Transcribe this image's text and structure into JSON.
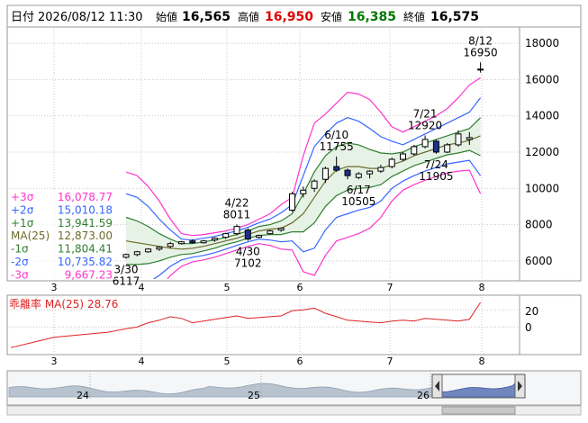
{
  "header": {
    "date_label": "日付",
    "datetime": "2026/08/12 11:30",
    "open_label": "始値",
    "open": "16,565",
    "high_label": "高値",
    "high": "16,950",
    "low_label": "安値",
    "low": "16,385",
    "close_label": "終値",
    "close": "16,575"
  },
  "colors": {
    "up": "#ffffff",
    "down": "#1f2f8f",
    "candle_edge": "#000000",
    "sigma3": "#ff33cc",
    "sigma2": "#3366ff",
    "sigma1": "#2f7f2f",
    "ma": "#6b6b2b",
    "band_fill": "#e6f2e6",
    "high_text": "#dd0000",
    "low_text": "#007700",
    "divergence": "#dd2222",
    "navigator_fill": "#b7c3cf",
    "navigator_selected": "#6f86bf"
  },
  "legend": [
    {
      "label": "+3σ",
      "value": "16,078.77",
      "color": "#ff33cc"
    },
    {
      "label": "+2σ",
      "value": "15,010.18",
      "color": "#3366ff"
    },
    {
      "label": "+1σ",
      "value": "13,941.59",
      "color": "#2f7f2f"
    },
    {
      "label": "MA(25)",
      "value": "12,873.00",
      "color": "#6b6b2b"
    },
    {
      "label": "-1σ",
      "value": "11,804.41",
      "color": "#2f7f2f"
    },
    {
      "label": "-2σ",
      "value": "10,735.82",
      "color": "#3366ff"
    },
    {
      "label": "-3σ",
      "value": "9,667.23",
      "color": "#ff33cc"
    }
  ],
  "divergence_panel": {
    "label": "乖離率 MA(25)",
    "value": "28.76",
    "y_ticks": [
      "20",
      "0"
    ]
  },
  "x_axis_months": [
    "3",
    "4",
    "5",
    "6",
    "7",
    "8"
  ],
  "navigator": {
    "labels": [
      "24",
      "25",
      "26"
    ]
  },
  "chart_data": {
    "type": "candlestick",
    "title": "",
    "xlabel": "",
    "ylabel": "",
    "y_ticks": [
      6000,
      8000,
      10000,
      12000,
      14000,
      16000,
      18000
    ],
    "ylim": [
      5000,
      18800
    ],
    "x_ticks": [
      "3",
      "4",
      "5",
      "6",
      "7",
      "8"
    ],
    "series": [
      {
        "name": "+3σ",
        "values": [
          10900,
          10700,
          10100,
          9300,
          8300,
          7500,
          7400,
          7450,
          7550,
          7650,
          7800,
          8000,
          8300,
          8600,
          9100,
          9500,
          11800,
          13600,
          14100,
          14700,
          15300,
          15200,
          14900,
          14200,
          13400,
          13100,
          13400,
          13700,
          14000,
          14400,
          15000,
          15700,
          16100
        ]
      },
      {
        "name": "+2σ",
        "values": [
          9700,
          9500,
          9000,
          8300,
          7700,
          7200,
          7150,
          7250,
          7350,
          7500,
          7650,
          7850,
          8100,
          8300,
          8650,
          9100,
          10700,
          12300,
          13000,
          13600,
          13900,
          13700,
          13300,
          12850,
          12600,
          12400,
          12700,
          13000,
          13300,
          13600,
          13900,
          14200,
          15000
        ]
      },
      {
        "name": "+1σ",
        "values": [
          8400,
          8200,
          7900,
          7500,
          7200,
          6950,
          6950,
          7050,
          7150,
          7300,
          7450,
          7650,
          7900,
          8000,
          8200,
          8600,
          9700,
          10900,
          11800,
          12300,
          12500,
          12400,
          12150,
          11950,
          11900,
          12000,
          12300,
          12500,
          12700,
          12900,
          13100,
          13300,
          13900
        ]
      },
      {
        "name": "MA(25)",
        "values": [
          7100,
          7000,
          6900,
          6800,
          6700,
          6650,
          6700,
          6800,
          6950,
          7100,
          7250,
          7450,
          7650,
          7750,
          7800,
          8100,
          8600,
          9500,
          10400,
          11000,
          11200,
          11200,
          11100,
          11100,
          11300,
          11500,
          11800,
          12000,
          12200,
          12400,
          12500,
          12650,
          12900
        ]
      },
      {
        "name": "-1σ",
        "values": [
          5800,
          5800,
          5850,
          6000,
          6200,
          6350,
          6400,
          6550,
          6700,
          6900,
          7050,
          7250,
          7400,
          7450,
          7450,
          7600,
          7600,
          8100,
          9000,
          9600,
          9900,
          10000,
          10050,
          10200,
          10650,
          10950,
          11250,
          11450,
          11650,
          11850,
          11950,
          12100,
          11800
        ]
      },
      {
        "name": "-2σ",
        "values": [
          4500,
          4600,
          4800,
          5200,
          5700,
          6050,
          6200,
          6300,
          6450,
          6650,
          6850,
          7050,
          7200,
          7150,
          7050,
          7100,
          6500,
          6700,
          7700,
          8400,
          8600,
          8800,
          8950,
          9300,
          10000,
          10400,
          10700,
          10950,
          11150,
          11350,
          11450,
          11550,
          10700
        ]
      },
      {
        "name": "-3σ",
        "values": [
          3200,
          3400,
          3700,
          4400,
          5200,
          5700,
          5950,
          6050,
          6200,
          6400,
          6600,
          6800,
          6950,
          6850,
          6650,
          6600,
          5400,
          5200,
          6300,
          7100,
          7300,
          7500,
          7800,
          8400,
          9300,
          9900,
          10200,
          10450,
          10650,
          10850,
          10950,
          11000,
          9700
        ]
      }
    ],
    "candles": [
      {
        "o": 6200,
        "h": 6400,
        "l": 6117,
        "c": 6350
      },
      {
        "o": 6350,
        "h": 6550,
        "l": 6250,
        "c": 6500
      },
      {
        "o": 6500,
        "h": 6700,
        "l": 6450,
        "c": 6650
      },
      {
        "o": 6650,
        "h": 6800,
        "l": 6550,
        "c": 6750
      },
      {
        "o": 6800,
        "h": 7050,
        "l": 6700,
        "c": 6950
      },
      {
        "o": 6950,
        "h": 7100,
        "l": 6900,
        "c": 7050
      },
      {
        "o": 7100,
        "h": 7200,
        "l": 6950,
        "c": 7000
      },
      {
        "o": 7000,
        "h": 7150,
        "l": 6950,
        "c": 7100
      },
      {
        "o": 7150,
        "h": 7300,
        "l": 7050,
        "c": 7250
      },
      {
        "o": 7300,
        "h": 7550,
        "l": 7200,
        "c": 7500
      },
      {
        "o": 7500,
        "h": 8011,
        "l": 7400,
        "c": 7900
      },
      {
        "o": 7700,
        "h": 7800,
        "l": 7102,
        "c": 7200
      },
      {
        "o": 7300,
        "h": 7450,
        "l": 7250,
        "c": 7400
      },
      {
        "o": 7500,
        "h": 7700,
        "l": 7450,
        "c": 7650
      },
      {
        "o": 7700,
        "h": 7850,
        "l": 7600,
        "c": 7800
      },
      {
        "o": 8800,
        "h": 9800,
        "l": 8700,
        "c": 9700
      },
      {
        "o": 9700,
        "h": 10100,
        "l": 9500,
        "c": 9900
      },
      {
        "o": 10000,
        "h": 10500,
        "l": 9800,
        "c": 10400
      },
      {
        "o": 10500,
        "h": 11200,
        "l": 10300,
        "c": 11100
      },
      {
        "o": 11200,
        "h": 11755,
        "l": 10900,
        "c": 11000
      },
      {
        "o": 11000,
        "h": 11100,
        "l": 10505,
        "c": 10700
      },
      {
        "o": 10600,
        "h": 10900,
        "l": 10505,
        "c": 10800
      },
      {
        "o": 10800,
        "h": 11000,
        "l": 10550,
        "c": 10950
      },
      {
        "o": 10950,
        "h": 11300,
        "l": 10850,
        "c": 11150
      },
      {
        "o": 11200,
        "h": 11700,
        "l": 11100,
        "c": 11600
      },
      {
        "o": 11600,
        "h": 12000,
        "l": 11500,
        "c": 11900
      },
      {
        "o": 11900,
        "h": 12400,
        "l": 11800,
        "c": 12300
      },
      {
        "o": 12300,
        "h": 12920,
        "l": 12200,
        "c": 12700
      },
      {
        "o": 12600,
        "h": 12700,
        "l": 11905,
        "c": 12000
      },
      {
        "o": 12000,
        "h": 12500,
        "l": 11950,
        "c": 12400
      },
      {
        "o": 12400,
        "h": 13200,
        "l": 12300,
        "c": 13000
      },
      {
        "o": 12700,
        "h": 13100,
        "l": 12400,
        "c": 12800
      },
      {
        "o": 16565,
        "h": 16950,
        "l": 16385,
        "c": 16575
      }
    ],
    "divergence_values": [
      -2,
      0,
      5,
      8,
      12,
      10,
      5,
      7,
      9,
      11,
      13,
      10,
      11,
      12,
      13,
      19,
      20,
      22,
      16,
      12,
      8,
      7,
      6,
      5,
      7,
      8,
      7,
      10,
      9,
      8,
      7,
      9,
      28.76
    ],
    "divergence_ylim": [
      -30,
      35
    ],
    "annotations": [
      {
        "date": "3/30",
        "value": "6117",
        "i": 0,
        "at": "low"
      },
      {
        "date": "4/22",
        "value": "8011",
        "i": 10,
        "at": "high"
      },
      {
        "date": "4/30",
        "value": "7102",
        "i": 11,
        "at": "low"
      },
      {
        "date": "6/10",
        "value": "11755",
        "i": 19,
        "at": "high"
      },
      {
        "date": "6/17",
        "value": "10505",
        "i": 21,
        "at": "low"
      },
      {
        "date": "7/21",
        "value": "12920",
        "i": 27,
        "at": "high"
      },
      {
        "date": "7/24",
        "value": "11905",
        "i": 28,
        "at": "low"
      },
      {
        "date": "8/12",
        "value": "16950",
        "i": 32,
        "at": "high"
      }
    ]
  }
}
